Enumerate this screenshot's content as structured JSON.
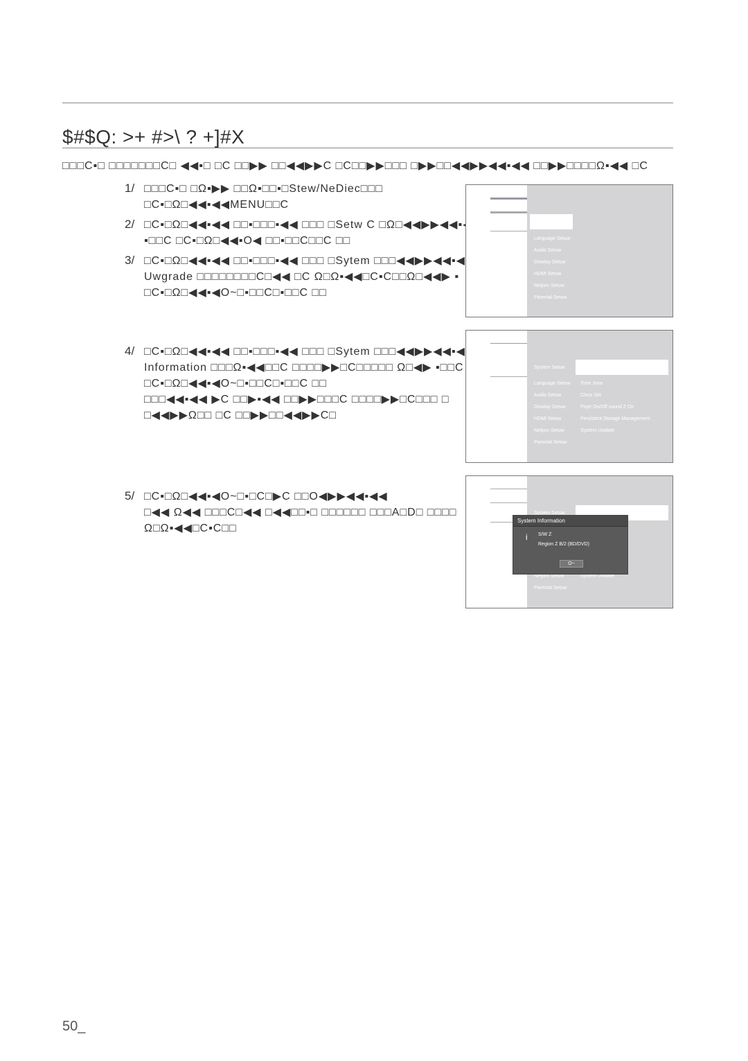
{
  "title": "$#$Q: >+ #>\\ ? +]#X",
  "intro": "□□□C▪□ □□□□□□□C□ ◀◀▪□ □C □□▶▶ □□◀◀▶▶C □C□□▶▶□□□ □▶▶□□◀◀▶▶◀◀▪◀◀ □□▶▶□□□□Ω▪◀◀ □C",
  "steps": [
    {
      "num": "1/",
      "lines": [
        "□□□C▪□ □Ω▪▶▶ □□Ω▪□□▪□Stew/NeDiec□□□",
        "□C▪□Ω□◀◀▪◀◀MENU□□C"
      ]
    },
    {
      "num": "2/",
      "lines": [
        "□C▪□Ω□◀◀▪◀◀ □□▪□□□▪◀◀ □□□ □Setw C □Ω□◀◀▶▶◀◀▪◀◀",
        "▪□□C □C▪□Ω□◀◀▪O◀ □□▪□□C□□C □□"
      ]
    },
    {
      "num": "3/",
      "lines": [
        "□C▪□Ω□◀◀▪◀◀ □□▪□□□▪◀◀ □□□ □Sytem □□□◀◀▶▶◀◀▪◀◀",
        "Uwgrade □□□□□□□□C□◀◀ □C Ω□Ω▪◀◀□C▪C□□Ω□◀◀▶ ▪",
        "□C▪□Ω□◀◀▪◀O~□▪□□C□▪□□C □□"
      ]
    },
    {
      "num": "4/",
      "lines": [
        "□C▪□Ω□◀◀▪◀◀ □□▪□□□▪◀◀ □□□ □Sytem □□□◀◀▶▶◀◀▪◀◀",
        "Information □□□Ω▪◀◀□□C □□□□▶▶□C□□□□□ Ω□◀▶ ▪□□C",
        "□C▪□Ω□◀◀▪◀O~□▪□□C□▪□□C □□",
        "□□□◀◀▪◀◀ ▶C □□▶▪◀◀ □□▶▶□□□C □□□□▶▶□C□□□ □",
        "□◀◀▶▶Ω□□ □C □□▶▶□□◀◀▶▶C□"
      ]
    },
    {
      "num": "5/",
      "lines": [
        "□C▪□Ω□◀◀▪◀O~□▪□C□▶C □□O◀▶▶◀◀▪◀◀",
        "□◀◀ Ω◀◀ □□□C□◀◀ □◀◀□□▪□ □□□□□□ □□□A□D□ □□□□",
        "Ω□Ω▪◀◀□C▪C□□"
      ]
    }
  ],
  "screen": {
    "menu": [
      "System Setuw",
      "Language Setuw",
      "Audio Setuw",
      "Diswlay Setuw",
      "HDMI Setuw",
      "Netjorx Setuw",
      "Parental Setuw"
    ],
    "submenu": [
      "Time Jone",
      "Clocx Set",
      "Pojer On/Off sound   Z  On",
      "Persistent Storage Management",
      "System Uwdate"
    ],
    "dialog": {
      "title": "System Information",
      "icon": "info-icon",
      "sw": "S/W Z",
      "region": "Region Z B/2 (BD/DVD)",
      "ok": "O~"
    }
  },
  "page_number": "50_"
}
